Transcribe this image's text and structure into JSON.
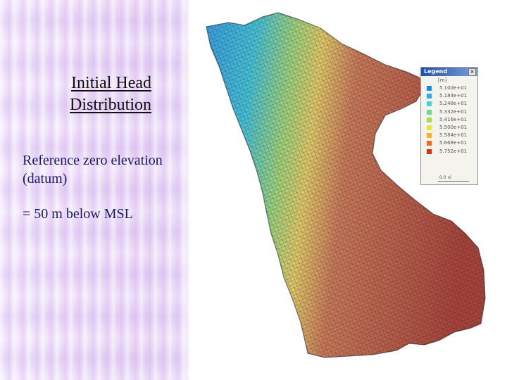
{
  "title": {
    "line1": "Initial Head",
    "line2": "Distribution"
  },
  "notes": {
    "line1": "Reference zero elevation (datum)",
    "line2": "= 50 m below MSL"
  },
  "legend": {
    "title": "Legend",
    "close": "×",
    "variable": "[m]",
    "scale_label": "0.0   nl",
    "entries": [
      {
        "label": "5.10de+01",
        "color": "#1e88e0"
      },
      {
        "label": "5.184e+01",
        "color": "#39a8e8"
      },
      {
        "label": "5.248e+01",
        "color": "#4fd0d8"
      },
      {
        "label": "5.332e+01",
        "color": "#6fd49a"
      },
      {
        "label": "5.416e+01",
        "color": "#a8d85a"
      },
      {
        "label": "5.500e+01",
        "color": "#e8e048"
      },
      {
        "label": "5.584e+01",
        "color": "#f0b030"
      },
      {
        "label": "5.668e+01",
        "color": "#e8701e"
      },
      {
        "label": "5.752e+01",
        "color": "#c83818"
      }
    ]
  },
  "map_colors": {
    "west": "#4fa8d8",
    "mid": "#c8d870",
    "east": "#b84a3e"
  }
}
